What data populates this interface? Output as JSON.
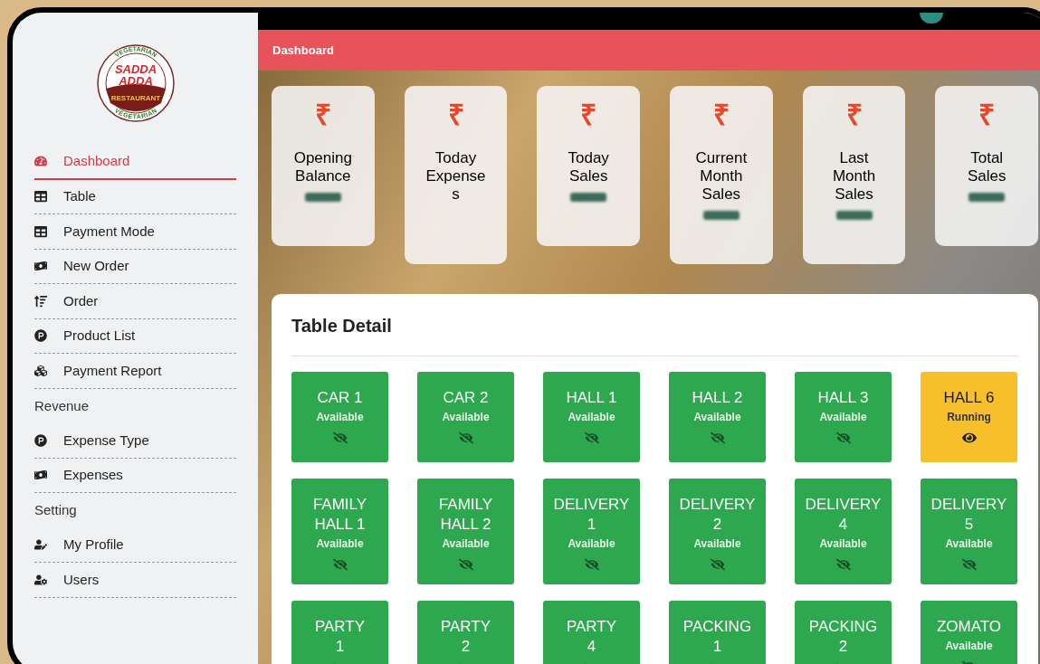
{
  "logo": {
    "top_arc": "VEGETARIAN",
    "line1": "SADDA",
    "line2": "ADDA",
    "banner": "RESTAURANT",
    "bottom_arc": "VEGETARIAN"
  },
  "sidebar": {
    "sections": [
      {
        "items": [
          {
            "label": "Dashboard",
            "selected": true
          },
          {
            "label": "Table",
            "selected": false
          },
          {
            "label": "Payment Mode",
            "selected": false
          },
          {
            "label": "New Order",
            "selected": false
          },
          {
            "label": "Order",
            "selected": false
          },
          {
            "label": "Product List",
            "selected": false
          },
          {
            "label": "Payment Report",
            "selected": false
          }
        ]
      },
      {
        "heading": "Revenue",
        "items": [
          {
            "label": "Expense Type",
            "selected": false
          },
          {
            "label": "Expenses",
            "selected": false
          }
        ]
      },
      {
        "heading": "Setting",
        "items": [
          {
            "label": "My Profile",
            "selected": false
          },
          {
            "label": "Users",
            "selected": false
          }
        ]
      }
    ]
  },
  "header": {
    "title": "Dashboard"
  },
  "stat_cards": [
    {
      "symbol": "₹",
      "title": "Opening\nBalance",
      "value_obscured": true
    },
    {
      "symbol": "₹",
      "title": "Today\nExpense\ns",
      "value_obscured": false
    },
    {
      "symbol": "₹",
      "title": "Today\nSales",
      "value_obscured": true
    },
    {
      "symbol": "₹",
      "title": "Current\nMonth\nSales",
      "value_obscured": true
    },
    {
      "symbol": "₹",
      "title": "Last\nMonth\nSales",
      "value_obscured": true
    },
    {
      "symbol": "₹",
      "title": "Total\nSales",
      "value_obscured": true
    }
  ],
  "table_detail": {
    "title": "Table Detail",
    "tables": [
      {
        "name": "CAR 1",
        "status": "Available",
        "kind": "available"
      },
      {
        "name": "CAR 2",
        "status": "Available",
        "kind": "available"
      },
      {
        "name": "HALL 1",
        "status": "Available",
        "kind": "available"
      },
      {
        "name": "HALL 2",
        "status": "Available",
        "kind": "available"
      },
      {
        "name": "HALL 3",
        "status": "Available",
        "kind": "available"
      },
      {
        "name": "HALL 6",
        "status": "Running",
        "kind": "running"
      },
      {
        "name": "FAMILY\nHALL 1",
        "status": "Available",
        "kind": "available"
      },
      {
        "name": "FAMILY\nHALL 2",
        "status": "Available",
        "kind": "available"
      },
      {
        "name": "DELIVERY\n1",
        "status": "Available",
        "kind": "available"
      },
      {
        "name": "DELIVERY\n2",
        "status": "Available",
        "kind": "available"
      },
      {
        "name": "DELIVERY\n4",
        "status": "Available",
        "kind": "available"
      },
      {
        "name": "DELIVERY\n5",
        "status": "Available",
        "kind": "available"
      },
      {
        "name": "PARTY\n1",
        "kind": "available"
      },
      {
        "name": "PARTY\n2",
        "kind": "available"
      },
      {
        "name": "PARTY\n4",
        "kind": "available"
      },
      {
        "name": "PACKING\n1",
        "kind": "available"
      },
      {
        "name": "PACKING\n2",
        "kind": "available"
      },
      {
        "name": "ZOMATO",
        "status": "Available",
        "kind": "available"
      }
    ]
  }
}
